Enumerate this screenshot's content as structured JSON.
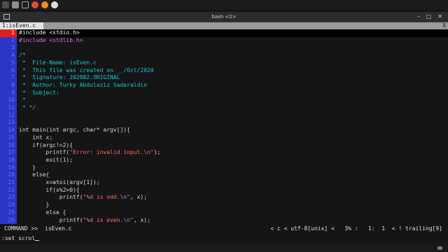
{
  "window": {
    "title": "bash <2>"
  },
  "tabline": {
    "active_tab": "1:isEven.c",
    "close": "X"
  },
  "lines": [
    {
      "n": "1",
      "text": "#include <stdio.h>"
    },
    {
      "n": "2",
      "text": "#include <stdlib.h>"
    },
    {
      "n": "3",
      "text": ""
    },
    {
      "n": "4",
      "text": "/*"
    },
    {
      "n": "5",
      "text": " *  File-Name: isEven.c"
    },
    {
      "n": "6",
      "text": " *  This file was created on __/Oct/2020"
    },
    {
      "n": "7",
      "text": " *  Signature: 202002.ORIGINAL"
    },
    {
      "n": "8",
      "text": " *  Author: Turky Abdulaziz Saderaldin"
    },
    {
      "n": "9",
      "text": " *  Subject:"
    },
    {
      "n": "10",
      "text": " *"
    },
    {
      "n": "11",
      "text": " * */"
    },
    {
      "n": "12",
      "text": ""
    },
    {
      "n": "13",
      "text": ""
    },
    {
      "n": "14",
      "text": "int main(int argc, char* argv[]){"
    },
    {
      "n": "15",
      "text": "    int x;"
    },
    {
      "n": "16",
      "text": "    if(argc!=2){"
    },
    {
      "n": "17",
      "text": "        printf(\"Error: invalid input.\\n\");"
    },
    {
      "n": "18",
      "text": "        exit(1);"
    },
    {
      "n": "19",
      "text": "    }"
    },
    {
      "n": "20",
      "text": "    else{"
    },
    {
      "n": "21",
      "text": "        x=atoi(argv[1]);"
    },
    {
      "n": "22",
      "text": "        if(x%2>0){"
    },
    {
      "n": "23",
      "text": "            printf(\"%d is odd.\\n\", x);"
    },
    {
      "n": "24",
      "text": "        }"
    },
    {
      "n": "25",
      "text": "        else {"
    },
    {
      "n": "26",
      "text": "            printf(\"%d is even.\\n\", x);"
    }
  ],
  "status": {
    "mode": "COMMAND >>",
    "file": "isEven.c",
    "right": "< c < utf-8[unix] <   3% :   1:  1  < ! trailing[9]"
  },
  "cmdline": {
    "text": ":set scrol"
  },
  "colors": {
    "gutter": "#2c36c4",
    "current_line_number": "#e02020",
    "comment": "#1bc6d2",
    "preproc": "#d76fd4",
    "string": "#ff6b6b"
  }
}
